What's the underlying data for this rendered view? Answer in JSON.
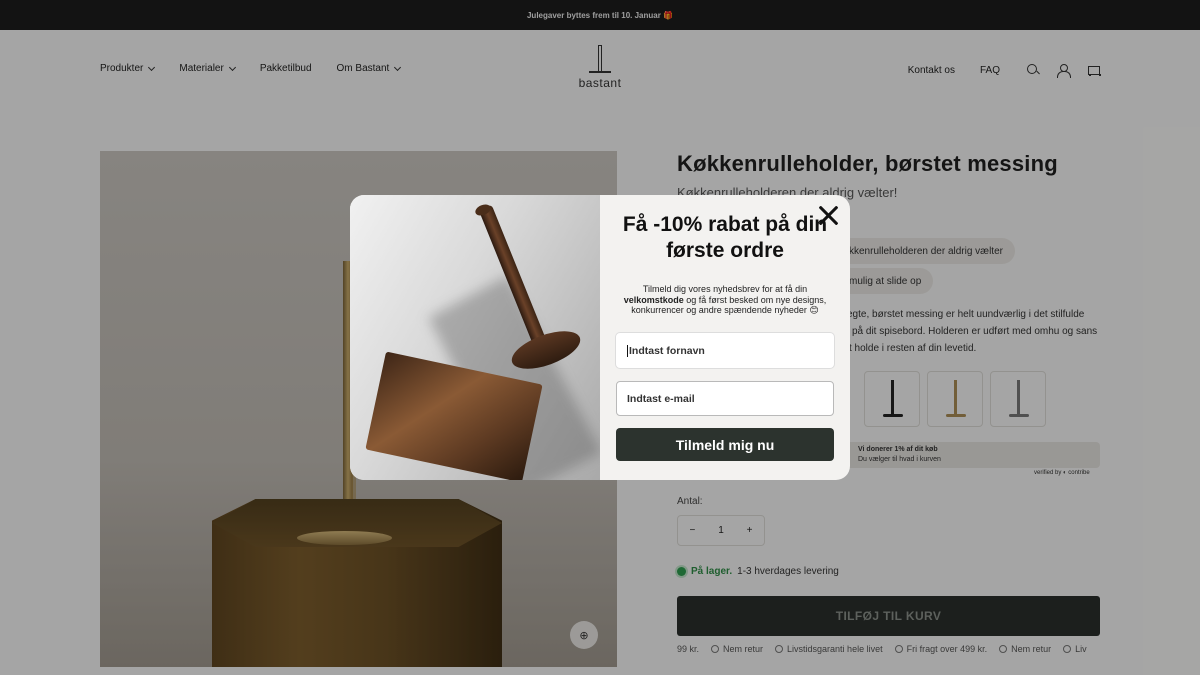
{
  "announcement": "Julegaver byttes frem til 10. Januar 🎁",
  "header": {
    "nav_left": [
      "Produkter",
      "Materialer",
      "Pakketilbud",
      "Om Bastant"
    ],
    "logo_text": "bastant",
    "nav_right": [
      "Kontakt os",
      "FAQ"
    ]
  },
  "product": {
    "title": "Køkkenrulleholder, børstet messing",
    "subtitle": "Køkkenrulleholderen der aldrig vælter!",
    "pill_1": "kkenrulleholderen der aldrig vælter",
    "pill_2": "mulig at slide op",
    "desc_1": "egte, børstet messing er helt uundværlig i det stilfulde",
    "desc_2": "på dit spisebord. Holderen er udført med omhu og sans",
    "desc_3": "t holde i resten af din levetid.",
    "contribe_1": "Vi donerer 1% af dit køb",
    "contribe_2": "Du vælger til hvad i kurven",
    "verified": "verified by ◐ contribe",
    "qty_label": "Antal:",
    "qty_minus": "−",
    "qty_value": "1",
    "qty_plus": "+",
    "stock_label": "På lager.",
    "stock_text": "1-3 hverdages levering",
    "add_to_cart": "TILFØJ TIL KURV",
    "usps": [
      "99 kr.",
      "Nem retur",
      "Livstidsgaranti hele livet",
      "Fri fragt over 499 kr.",
      "Nem retur",
      "Liv"
    ],
    "zoom_icon": "⊕"
  },
  "popup": {
    "title": "Få -10% rabat på din første ordre",
    "text_before": "Tilmeld dig vores nyhedsbrev for at få din",
    "text_bold": "velkomstkode",
    "text_after": "og få først besked om nye designs, konkurrencer og andre spændende nyheder 😊",
    "firstname_placeholder": "Indtast fornavn",
    "email_placeholder": "Indtast e-mail",
    "submit_label": "Tilmeld mig nu"
  },
  "colors": {
    "accent": "#2c332e",
    "stock_green": "#2e9b4e",
    "announcement_bg": "#1c1c1c"
  }
}
